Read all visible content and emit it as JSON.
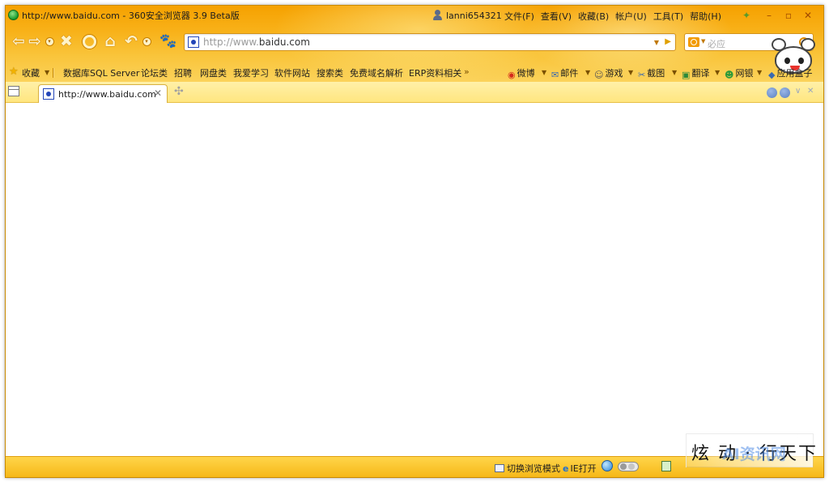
{
  "window": {
    "title": "http://www.baidu.com - 360安全浏览器 3.9 Beta版",
    "user": "lanni654321",
    "menu": [
      "文件(F)",
      "查看(V)",
      "收藏(B)",
      "帐户(U)",
      "工具(T)",
      "帮助(H)"
    ],
    "controls": {
      "pin": "✦",
      "minimize": "–",
      "maximize": "▫",
      "close": "✕"
    }
  },
  "navbar": {
    "back_icon": "back-arrow-icon",
    "forward_icon": "forward-arrow-icon",
    "address": {
      "prefix": "http://www.",
      "domain": "baidu.com"
    },
    "search": {
      "placeholder": "必应"
    }
  },
  "bookmarks": {
    "favorites_label": "收藏",
    "left_items": [
      "数据库SQL Server",
      "论坛类",
      "招聘",
      "网盘类",
      "我爱学习",
      "软件网站",
      "搜索类",
      "免费域名解析",
      "ERP资料相关"
    ],
    "overflow": "»",
    "right_items": [
      "微博",
      "邮件",
      "游戏",
      "截图",
      "翻译",
      "网银",
      "应用盒子"
    ]
  },
  "tabs": {
    "items": [
      {
        "title": "http://www.baidu.com",
        "close": "✕"
      }
    ],
    "new_tab": "✣"
  },
  "statusbar": {
    "mode_label": "切换浏览模式",
    "ie_label": "IE打开",
    "ie_prefix": "e"
  },
  "watermark": {
    "text": "炫 动 · 行天下",
    "overlay": "AI资讯网"
  },
  "colors": {
    "chrome_top": "#f6a100",
    "chrome_bottom": "#fbd25a",
    "tabbar": "#ffe680",
    "statusbar": "#f6b818"
  }
}
